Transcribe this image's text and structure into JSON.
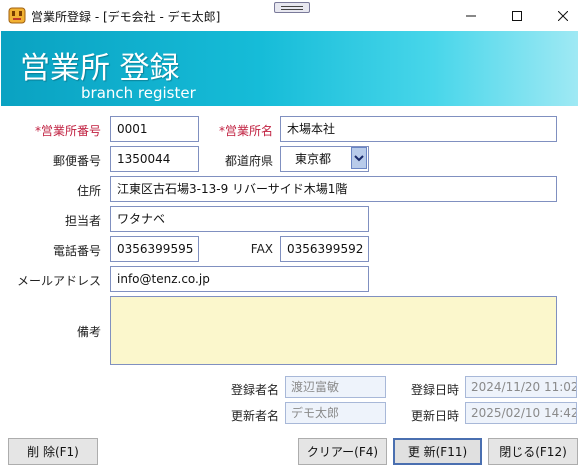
{
  "window": {
    "title": "営業所登録 - [デモ会社 - デモ太郎]",
    "minimize_icon": "minimize-icon",
    "maximize_icon": "maximize-icon",
    "close_icon": "close-icon"
  },
  "banner": {
    "title": "営業所 登録",
    "subtitle": "branch register",
    "colors": [
      "#0aa2c2",
      "#48d6ea",
      "#9fe9f4"
    ]
  },
  "form": {
    "branch_no": {
      "label": "*営業所番号",
      "value": "0001"
    },
    "branch_name": {
      "label": "*営業所名",
      "value": "木場本社"
    },
    "postal_code": {
      "label": "郵便番号",
      "value": "1350044"
    },
    "prefecture": {
      "label": "都道府県",
      "value": "東京都"
    },
    "address": {
      "label": "住所",
      "value": "江東区古石場3-13-9 リバーサイド木場1階"
    },
    "contact": {
      "label": "担当者",
      "value": "ワタナベ"
    },
    "phone": {
      "label": "電話番号",
      "value": "0356399595"
    },
    "fax": {
      "label": "FAX",
      "value": "0356399592"
    },
    "email": {
      "label": "メールアドレス",
      "value": "info@tenz.co.jp"
    },
    "memo": {
      "label": "備考",
      "value": ""
    }
  },
  "meta": {
    "registered_by": {
      "label": "登録者名",
      "value": "渡辺富敏"
    },
    "registered_at": {
      "label": "登録日時",
      "value": "2024/11/20 11:02"
    },
    "updated_by": {
      "label": "更新者名",
      "value": "デモ太郎"
    },
    "updated_at": {
      "label": "更新日時",
      "value": "2025/02/10 14:42"
    }
  },
  "buttons": {
    "delete": "削 除(F1)",
    "clear": "クリアー(F4)",
    "update": "更 新(F11)",
    "close": "閉じる(F12)"
  },
  "colors": {
    "required": "#c02040",
    "memo_bg": "#fbf7cc",
    "readonly_bg": "#eef3fb",
    "border": "#8090c0"
  }
}
